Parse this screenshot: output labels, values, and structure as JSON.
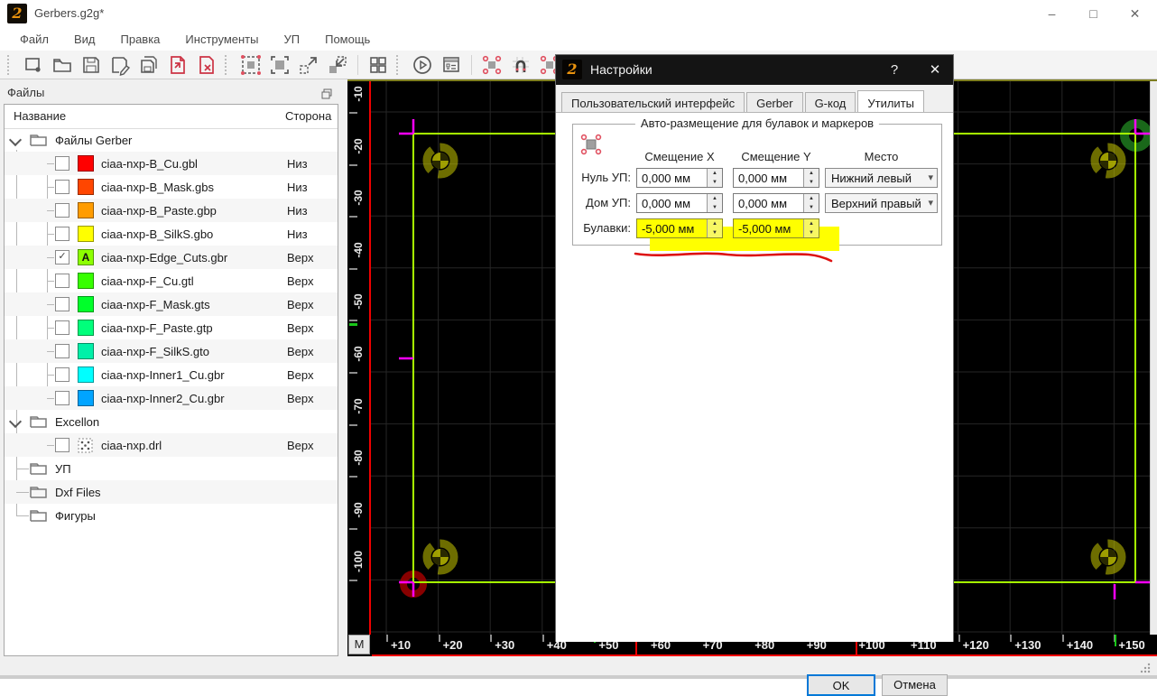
{
  "window": {
    "title": "Gerbers.g2g*",
    "minimize": "–",
    "maximize": "□",
    "close": "✕"
  },
  "menu": {
    "items": [
      "Файл",
      "Вид",
      "Правка",
      "Инструменты",
      "УП",
      "Помощь"
    ]
  },
  "toolbar": {
    "items": [
      "handle",
      "new-file-icon",
      "open-file-icon",
      "save-icon",
      "save-as-icon",
      "save-all-icon",
      "import-red-icon",
      "close-file-red-icon",
      "handle",
      "zoom-fit-icon",
      "zoom-window-icon",
      "zoom-out-selection-icon",
      "zoom-in-selection-icon",
      "line",
      "tile-views-icon",
      "handle",
      "run-icon",
      "job-form-icon",
      "line",
      "corner-markers-icon",
      "snap-magnet-icon",
      "corner-pins-icon",
      "handle",
      "pin-place-icon"
    ]
  },
  "files_panel": {
    "title": "Файлы",
    "columns": {
      "name": "Название",
      "side": "Сторона"
    },
    "tree": [
      {
        "kind": "folder",
        "label": "Файлы Gerber",
        "expanded": true
      },
      {
        "kind": "file",
        "label": "ciaa-nxp-B_Cu.gbl",
        "side": "Низ",
        "color": "#ff0000",
        "checked": false
      },
      {
        "kind": "file",
        "label": "ciaa-nxp-B_Mask.gbs",
        "side": "Низ",
        "color": "#ff4600",
        "checked": false
      },
      {
        "kind": "file",
        "label": "ciaa-nxp-B_Paste.gbp",
        "side": "Низ",
        "color": "#ff9c00",
        "checked": false
      },
      {
        "kind": "file",
        "label": "ciaa-nxp-B_SilkS.gbo",
        "side": "Низ",
        "color": "#ffff00",
        "checked": false
      },
      {
        "kind": "file",
        "label": "ciaa-nxp-Edge_Cuts.gbr",
        "side": "Верх",
        "color": "#8cff00",
        "checked": true,
        "badge": "A"
      },
      {
        "kind": "file",
        "label": "ciaa-nxp-F_Cu.gtl",
        "side": "Верх",
        "color": "#37ff00",
        "checked": false
      },
      {
        "kind": "file",
        "label": "ciaa-nxp-F_Mask.gts",
        "side": "Верх",
        "color": "#00ff2a",
        "checked": false
      },
      {
        "kind": "file",
        "label": "ciaa-nxp-F_Paste.gtp",
        "side": "Верх",
        "color": "#00ff7b",
        "checked": false
      },
      {
        "kind": "file",
        "label": "ciaa-nxp-F_SilkS.gto",
        "side": "Верх",
        "color": "#00f0a8",
        "checked": false
      },
      {
        "kind": "file",
        "label": "ciaa-nxp-Inner1_Cu.gbr",
        "side": "Верх",
        "color": "#00ffff",
        "checked": false
      },
      {
        "kind": "file",
        "label": "ciaa-nxp-Inner2_Cu.gbr",
        "side": "Верх",
        "color": "#00a4ff",
        "checked": false
      },
      {
        "kind": "folder",
        "label": "Excellon",
        "expanded": true
      },
      {
        "kind": "file",
        "label": "ciaa-nxp.drl",
        "side": "Верх",
        "icon": "drill",
        "checked": false
      },
      {
        "kind": "folder",
        "label": "УП",
        "expanded": false
      },
      {
        "kind": "folder",
        "label": "Dxf Files",
        "expanded": false
      },
      {
        "kind": "folder",
        "label": "Фигуры",
        "expanded": false
      }
    ]
  },
  "canvas": {
    "m_button": "M",
    "h_ruler_labels": [
      "+10",
      "+20",
      "+30",
      "+40",
      "+50",
      "+60",
      "+70",
      "+80",
      "+90",
      "+100",
      "+110",
      "+120",
      "+130",
      "+140",
      "+150"
    ],
    "v_ruler_labels": [
      "-10",
      "-20",
      "-30",
      "-40",
      "-50",
      "-60",
      "-70",
      "-80",
      "-90",
      "-100"
    ],
    "board_outline_color": "#a6ff00",
    "crosshair_color": "#ff00ff",
    "axis_color": "#f00000"
  },
  "dialog": {
    "title": "Настройки",
    "help": "?",
    "close": "✕",
    "tabs": [
      {
        "label": "Пользовательский интерфейс",
        "active": false
      },
      {
        "label": "Gerber",
        "active": false
      },
      {
        "label": "G-код",
        "active": false
      },
      {
        "label": "Утилиты",
        "active": true
      }
    ],
    "group_title": "Авто-размещение для булавок и маркеров",
    "col_headers": {
      "x": "Смещение X",
      "y": "Смещение Y",
      "place": "Место"
    },
    "rows": [
      {
        "label": "Нуль УП:",
        "x": "0,000 мм",
        "y": "0,000 мм",
        "place": "Нижний левый",
        "highlight": false
      },
      {
        "label": "Дом УП:",
        "x": "0,000 мм",
        "y": "0,000 мм",
        "place": "Верхний правый",
        "highlight": false
      },
      {
        "label": "Булавки:",
        "x": "-5,000 мм",
        "y": "-5,000 мм",
        "place": null,
        "highlight": true
      }
    ],
    "ok": "OK",
    "cancel": "Отмена",
    "highlight_color": "#ffff00",
    "focus_color": "#0078d7"
  }
}
